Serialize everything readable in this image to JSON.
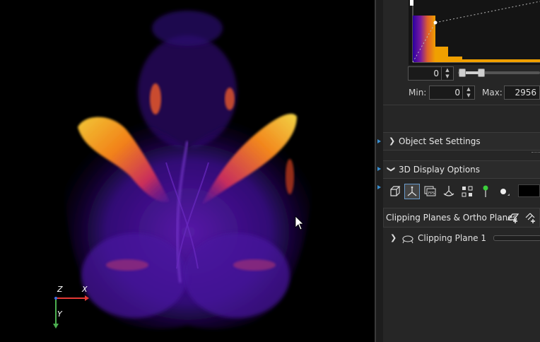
{
  "histogram": {
    "min_value": "0",
    "range_start_value": "0",
    "max_value": "2956",
    "min_label": "Min:",
    "max_label": "Max:"
  },
  "sections": {
    "object_set_settings": "Object Set Settings",
    "display_3d_options": "3D Display Options",
    "clipping_planes": "Clipping Planes & Ortho Planes"
  },
  "toolbar_icons": [
    "bounding-box-icon",
    "axes-icon",
    "fps-icon",
    "camera-orbit-icon",
    "selection-icon",
    "light-point-icon",
    "background-color-icon"
  ],
  "clipping_planes_list": [
    {
      "label": "Clipping Plane 1"
    }
  ],
  "axes": {
    "z": "Z",
    "x": "X",
    "y": "Y"
  },
  "colors": {
    "panel_bg": "#262626",
    "accent": "#3a8fd0",
    "axis_x": "#e53935",
    "axis_y": "#4caf50",
    "axis_z": "#4169e1"
  }
}
